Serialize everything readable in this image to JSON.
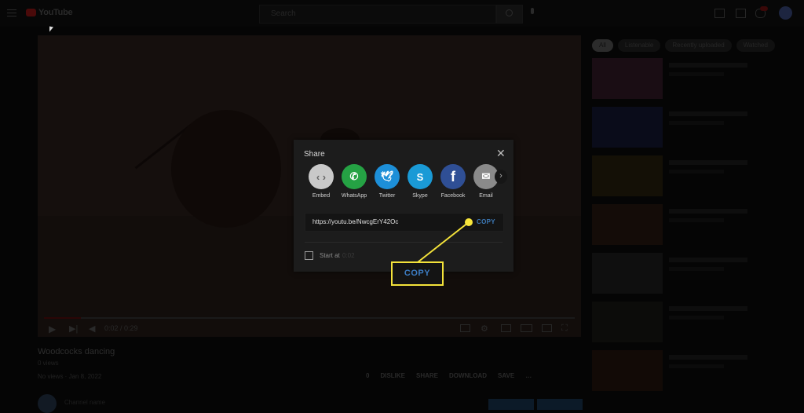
{
  "topbar": {
    "logo_text": "YouTube",
    "search_placeholder": "Search",
    "icons": [
      "menu-icon",
      "search-icon",
      "mic-icon",
      "create-icon",
      "apps-icon",
      "notifications-icon",
      "avatar"
    ],
    "notification_badge": "9+"
  },
  "video": {
    "time_display": "0:02 / 0:29",
    "progress_fraction": 0.07,
    "controls": [
      "play",
      "next",
      "volume",
      "captions",
      "settings",
      "miniplayer",
      "theater",
      "cast",
      "fullscreen"
    ]
  },
  "share_dialog": {
    "title": "Share",
    "targets": [
      {
        "label": "Embed",
        "icon": "embed-icon",
        "color": "#c9c9c9",
        "glyph": "‹ ›"
      },
      {
        "label": "WhatsApp",
        "icon": "whatsapp-icon",
        "color": "#25a244",
        "glyph": "✆"
      },
      {
        "label": "Twitter",
        "icon": "twitter-icon",
        "color": "#1d8fd8",
        "glyph": "🕊"
      },
      {
        "label": "Skype",
        "icon": "skype-icon",
        "color": "#1a9ad6",
        "glyph": "S"
      },
      {
        "label": "Facebook",
        "icon": "facebook-icon",
        "color": "#2f4f95",
        "glyph": "f"
      },
      {
        "label": "Email",
        "icon": "email-icon",
        "color": "#8a8a8a",
        "glyph": "✉"
      }
    ],
    "next_glyph": "›",
    "url": "https://youtu.be/NwcgErY42Oc",
    "copy_label": "COPY",
    "start_at_label": "Start at",
    "start_at_time": "0:02",
    "start_at_checked": false
  },
  "annotation": {
    "callout_label": "COPY",
    "color": "#f3e23a"
  },
  "video_info": {
    "title": "Woodcocks dancing",
    "channel_sub": "0 views",
    "meta": "No views · Jan 8, 2022",
    "actions": [
      {
        "label": "0",
        "icon": "like-icon"
      },
      {
        "label": "DISLIKE",
        "icon": "dislike-icon"
      },
      {
        "label": "SHARE",
        "icon": "share-icon"
      },
      {
        "label": "DOWNLOAD",
        "icon": "download-icon"
      },
      {
        "label": "SAVE",
        "icon": "save-icon"
      },
      {
        "label": "…",
        "icon": "more-icon"
      }
    ],
    "channel_name": "Channel name"
  },
  "sidebar": {
    "chips": [
      {
        "label": "All",
        "active": true
      },
      {
        "label": "Listenable",
        "active": false
      },
      {
        "label": "Recently uploaded",
        "active": false
      },
      {
        "label": "Watched",
        "active": false
      }
    ],
    "thumb_colors": [
      "#1a0d14",
      "#0a0c1a",
      "#141006",
      "#140c08",
      "#0f0f0f",
      "#0c0c0a",
      "#120a06"
    ]
  }
}
